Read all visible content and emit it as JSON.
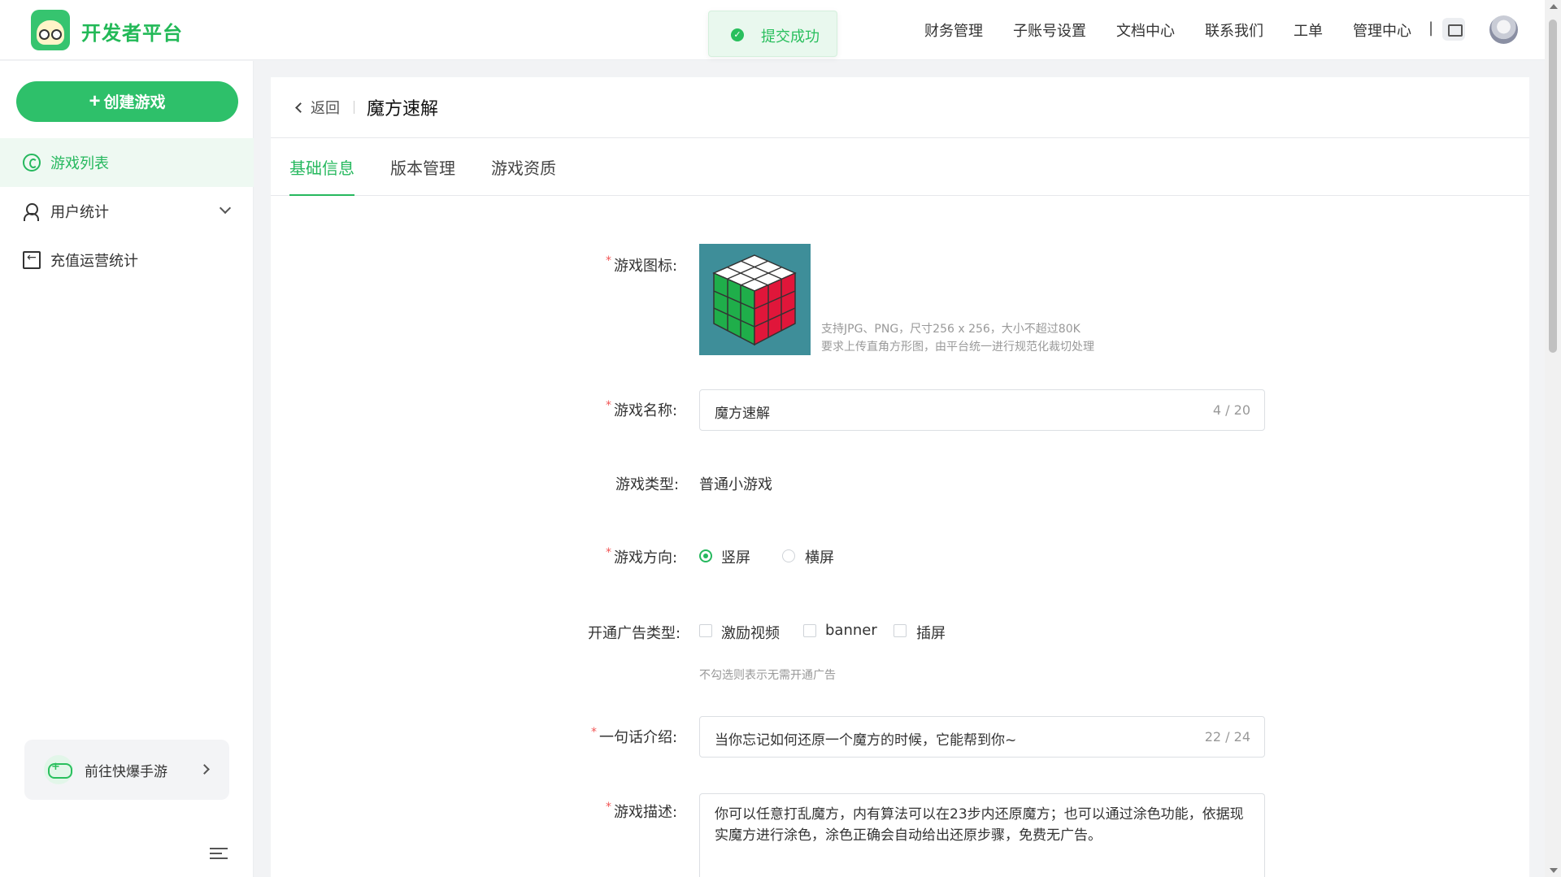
{
  "header": {
    "brand": "开发者平台",
    "toast": "提交成功",
    "nav": [
      "财务管理",
      "子账号设置",
      "文档中心",
      "联系我们",
      "工单",
      "管理中心"
    ],
    "separator": "|"
  },
  "sidebar": {
    "create_button": "创建游戏",
    "items": [
      {
        "label": "游戏列表",
        "icon": "game-list-icon",
        "active": true
      },
      {
        "label": "用户统计",
        "icon": "user-stats-icon",
        "expandable": true
      },
      {
        "label": "充值运营统计",
        "icon": "recharge-icon"
      }
    ],
    "goto_label": "前往快爆手游"
  },
  "page": {
    "back_label": "返回",
    "title": "魔方速解",
    "tabs": [
      "基础信息",
      "版本管理",
      "游戏资质"
    ],
    "active_tab": 0
  },
  "form": {
    "icon_label": "游戏图标:",
    "icon_hint_1": "支持JPG、PNG，尺寸256 x 256，大小不超过80K",
    "icon_hint_2": "要求上传直角方形图，由平台统一进行规范化裁切处理",
    "name_label": "游戏名称:",
    "name_value": "魔方速解",
    "name_count": "4 / 20",
    "type_label": "游戏类型:",
    "type_value": "普通小游戏",
    "orientation_label": "游戏方向:",
    "orientation_options": [
      "竖屏",
      "横屏"
    ],
    "orientation_selected": "竖屏",
    "ad_label": "开通广告类型:",
    "ad_options": [
      "激励视频",
      "banner",
      "插屏"
    ],
    "ad_hint": "不勾选则表示无需开通广告",
    "intro_label": "一句话介绍:",
    "intro_value": "当你忘记如何还原一个魔方的时候，它能帮到你~",
    "intro_count": "22 / 24",
    "desc_label": "游戏描述:",
    "desc_value": "你可以任意打乱魔方，内有算法可以在23步内还原魔方；也可以通过涂色功能，依据现实魔方进行涂色，涂色正确会自动给出还原步骤，免费无广告。"
  },
  "colors": {
    "accent": "#26b85e",
    "required": "#f25555",
    "icon_bg": "#3e8e99"
  }
}
